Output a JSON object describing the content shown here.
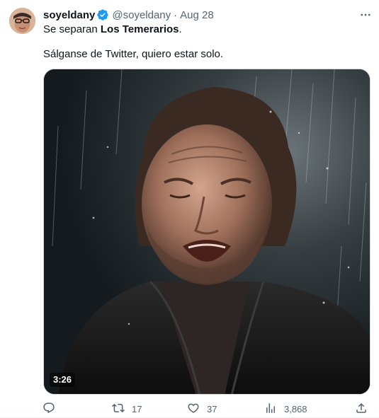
{
  "tweet": {
    "author": {
      "display_name": "soyeldany",
      "handle": "@soyeldany",
      "verified_icon": "verified-badge-icon",
      "verified_color": "#1d9bf0"
    },
    "separator": "·",
    "date": "Aug 28",
    "text_line1_prefix": "Se separan ",
    "text_line1_bold": "Los Temerarios",
    "text_line1_suffix": ".",
    "text_line2": "Sálganse de Twitter, quiero estar solo.",
    "media": {
      "duration": "3:26"
    },
    "actions": {
      "reply_icon": "reply-icon",
      "retweet_icon": "retweet-icon",
      "retweets": "17",
      "like_icon": "heart-icon",
      "likes": "37",
      "views_icon": "views-bar-chart-icon",
      "views": "3,868",
      "share_icon": "share-icon"
    },
    "more_icon": "more-options-icon",
    "colors": {
      "text": "#0f1419",
      "secondary": "#536471",
      "accent": "#1d9bf0"
    }
  }
}
